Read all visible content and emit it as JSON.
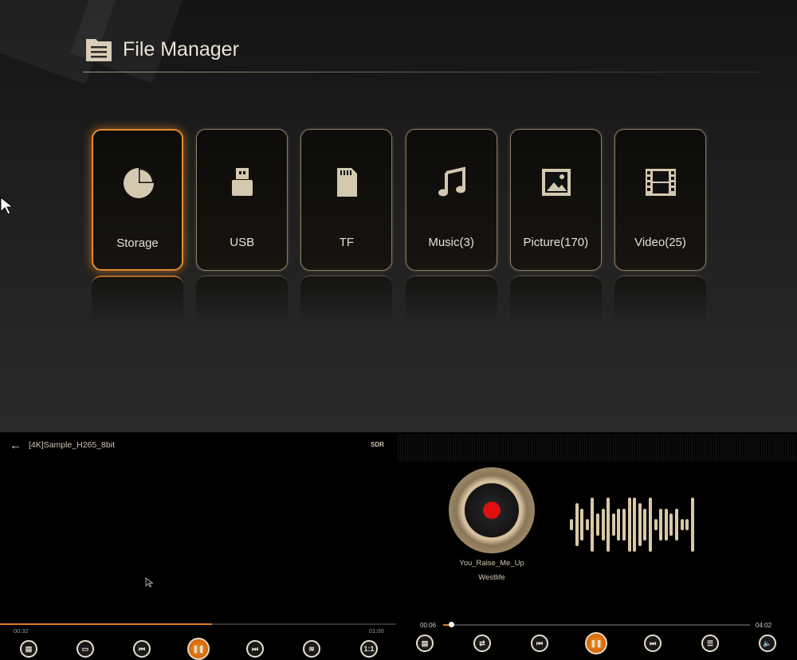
{
  "header": {
    "title": "File Manager"
  },
  "categories": [
    {
      "label": "Storage",
      "icon": "pie-chart-icon",
      "selected": true
    },
    {
      "label": "USB",
      "icon": "usb-icon",
      "selected": false
    },
    {
      "label": "TF",
      "icon": "sd-card-icon",
      "selected": false
    },
    {
      "label": "Music(3)",
      "icon": "music-note-icon",
      "selected": false
    },
    {
      "label": "Picture(170)",
      "icon": "picture-icon",
      "selected": false
    },
    {
      "label": "Video(25)",
      "icon": "film-icon",
      "selected": false
    }
  ],
  "video_player": {
    "title": "[4K]Sample_H265_8bit",
    "badge": "SDR",
    "elapsed": "00:32",
    "duration": "01:00",
    "progress": 0.535,
    "controls": [
      "playlist",
      "subtitle",
      "previous",
      "pause",
      "next",
      "audio-track",
      "ratio"
    ],
    "ratio_label": "1:1"
  },
  "music_player": {
    "song": "You_Raise_Me_Up",
    "artist": "Westlife",
    "elapsed": "00:06",
    "duration": "04:02",
    "progress": 0.025,
    "controls": [
      "playlist",
      "repeat",
      "previous",
      "pause",
      "next",
      "equalizer",
      "volume"
    ],
    "waveform": [
      0.2,
      0.8,
      0.6,
      0.2,
      1,
      0.4,
      0.6,
      1,
      0.4,
      0.6,
      0.6,
      1,
      1,
      0.8,
      0.6,
      1,
      0.2,
      0.6,
      0.6,
      0.4,
      0.6,
      0.2,
      0.2,
      1
    ]
  },
  "colors": {
    "accent": "#e08a2c",
    "gold": "#d9c8a8"
  }
}
